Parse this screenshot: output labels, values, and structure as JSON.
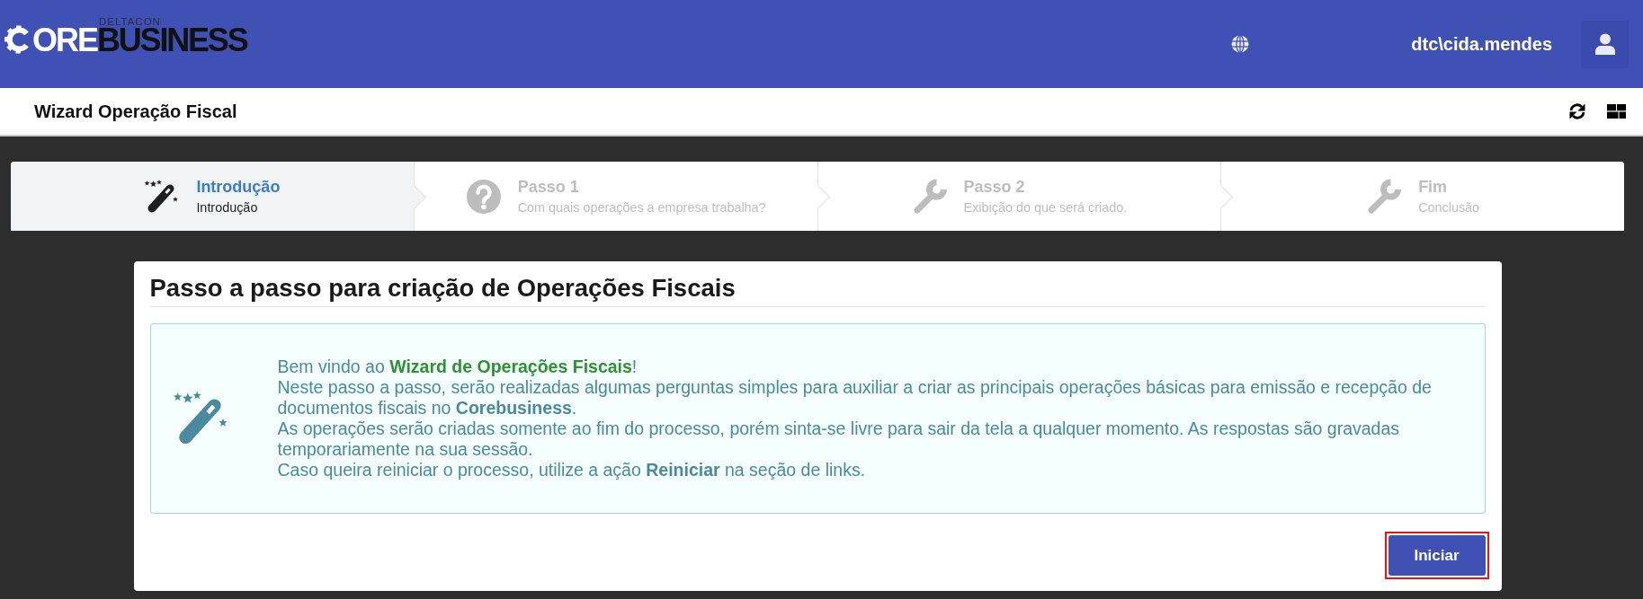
{
  "header": {
    "logo": {
      "overline": "DELTACON",
      "light": "ORE",
      "dark": "BUSINESS"
    },
    "username": "dtc\\cida.mendes"
  },
  "page_title": "Wizard Operação Fiscal",
  "steps": [
    {
      "title": "Introdução",
      "subtitle": "Introdução",
      "selected": true
    },
    {
      "title": "Passo 1",
      "subtitle": "Com quais operações a empresa trabalha?",
      "selected": false
    },
    {
      "title": "Passo 2",
      "subtitle": "Exibição do que será criado.",
      "selected": false
    },
    {
      "title": "Fim",
      "subtitle": "Conclusão",
      "selected": false
    }
  ],
  "card": {
    "title": "Passo a passo para criação de Operações Fiscais",
    "message": [
      "Bem vindo ao **Wizard de Operações Fiscais**!",
      "Neste passo a passo, serão realizadas algumas perguntas simples para auxiliar a criar as principais operações básicas para emissão e recepção de documentos fiscais no **Corebusiness**.",
      "As operações serão criadas somente ao fim do processo, porém sinta-se livre para sair da tela a qualquer momento. As respostas são gravadas temporariamente na sua sessão.",
      "Caso queira reiniciar o processo, utilize a ação **Reiniciar** na seção de links."
    ],
    "button": {
      "label": "Iniciar",
      "highlighted": true
    }
  }
}
